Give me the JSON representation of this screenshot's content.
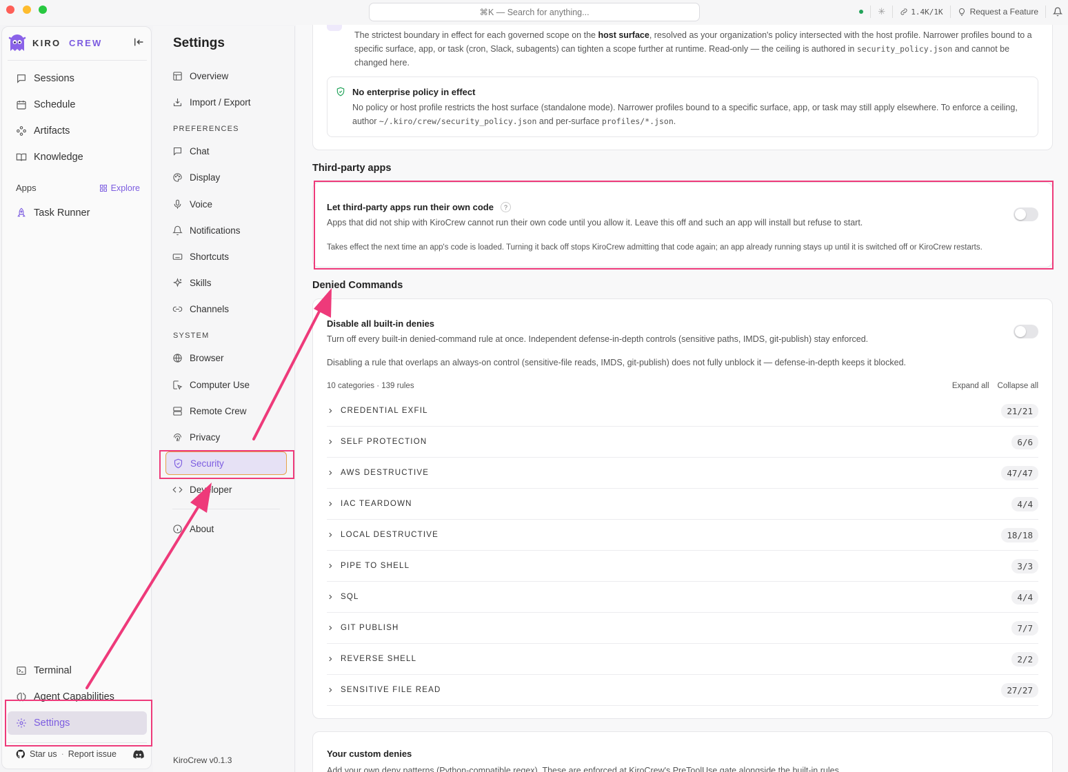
{
  "titlebar": {
    "search_placeholder": "⌘K — Search for anything...",
    "tokens": "1.4K/1K",
    "request_feature": "Request a Feature"
  },
  "sidebar": {
    "brand_kiro": "KIRO",
    "brand_crew": "CREW",
    "items": [
      {
        "label": "Sessions",
        "icon": "chat-bubble-icon"
      },
      {
        "label": "Schedule",
        "icon": "calendar-icon"
      },
      {
        "label": "Artifacts",
        "icon": "artifacts-icon"
      },
      {
        "label": "Knowledge",
        "icon": "book-icon"
      }
    ],
    "apps_label": "Apps",
    "explore_label": "Explore",
    "apps": [
      {
        "label": "Task Runner",
        "icon": "rocket-icon"
      }
    ],
    "bottom": [
      {
        "label": "Terminal",
        "icon": "terminal-icon"
      },
      {
        "label": "Agent Capabilities",
        "icon": "brain-icon"
      },
      {
        "label": "Settings",
        "icon": "gear-icon"
      }
    ],
    "star_us": "Star us",
    "dot": "·",
    "report_issue": "Report issue"
  },
  "settings_nav": {
    "title": "Settings",
    "top": [
      {
        "label": "Overview",
        "icon": "layout-icon"
      },
      {
        "label": "Import / Export",
        "icon": "import-icon"
      }
    ],
    "preferences_label": "PREFERENCES",
    "preferences": [
      {
        "label": "Chat",
        "icon": "chat-icon"
      },
      {
        "label": "Display",
        "icon": "palette-icon"
      },
      {
        "label": "Voice",
        "icon": "mic-icon"
      },
      {
        "label": "Notifications",
        "icon": "bell-icon"
      },
      {
        "label": "Shortcuts",
        "icon": "keyboard-icon"
      },
      {
        "label": "Skills",
        "icon": "sparkle-icon"
      },
      {
        "label": "Channels",
        "icon": "link-icon"
      }
    ],
    "system_label": "SYSTEM",
    "system": [
      {
        "label": "Browser",
        "icon": "globe-icon"
      },
      {
        "label": "Computer Use",
        "icon": "cursor-icon"
      },
      {
        "label": "Remote Crew",
        "icon": "server-icon"
      },
      {
        "label": "Privacy",
        "icon": "fingerprint-icon"
      },
      {
        "label": "Security",
        "icon": "shield-icon"
      },
      {
        "label": "Developer",
        "icon": "code-icon"
      }
    ],
    "about": "About",
    "version": "KiroCrew v0.1.3"
  },
  "policy": {
    "desc_1": "The strictest boundary in effect for each governed scope on the ",
    "desc_bold": "host surface",
    "desc_2": ", resolved as your organization's policy intersected with the host profile. Narrower profiles bound to a specific surface, app, or task (cron, Slack, subagents) can tighten a scope further at runtime. Read-only — the ceiling is authored in ",
    "desc_code": "security_policy.json",
    "desc_3": " and cannot be changed here.",
    "notice_title": "No enterprise policy in effect",
    "notice_1": "No policy or host profile restricts the host surface (standalone mode). Narrower profiles bound to a specific surface, app, or task may still apply elsewhere. To enforce a ceiling, author ",
    "notice_code1": "~/.kiro/crew/security_policy.json",
    "notice_2": " and per-surface ",
    "notice_code2": "profiles/*.json",
    "notice_3": "."
  },
  "third_party": {
    "title": "Third-party apps",
    "setting_title": "Let third-party apps run their own code",
    "help": "?",
    "desc": "Apps that did not ship with KiroCrew cannot run their own code until you allow it. Leave this off and such an app will install but refuse to start.",
    "note": "Takes effect the next time an app's code is loaded. Turning it back off stops KiroCrew admitting that code again; an app already running stays up until it is switched off or KiroCrew restarts.",
    "enabled": false
  },
  "denied": {
    "title": "Denied Commands",
    "setting_title": "Disable all built-in denies",
    "desc": "Turn off every built-in denied-command rule at once. Independent defense-in-depth controls (sensitive paths, IMDS, git-publish) stay enforced.",
    "note": "Disabling a rule that overlaps an always-on control (sensitive-file reads, IMDS, git-publish) does not fully unblock it — defense-in-depth keeps it blocked.",
    "enabled": false,
    "summary": "10 categories · 139 rules",
    "expand_all": "Expand all",
    "collapse_all": "Collapse all",
    "categories": [
      {
        "name": "CREDENTIAL EXFIL",
        "count": "21/21"
      },
      {
        "name": "SELF PROTECTION",
        "count": "6/6"
      },
      {
        "name": "AWS DESTRUCTIVE",
        "count": "47/47"
      },
      {
        "name": "IAC TEARDOWN",
        "count": "4/4"
      },
      {
        "name": "LOCAL DESTRUCTIVE",
        "count": "18/18"
      },
      {
        "name": "PIPE TO SHELL",
        "count": "3/3"
      },
      {
        "name": "SQL",
        "count": "4/4"
      },
      {
        "name": "GIT PUBLISH",
        "count": "7/7"
      },
      {
        "name": "REVERSE SHELL",
        "count": "2/2"
      },
      {
        "name": "SENSITIVE FILE READ",
        "count": "27/27"
      }
    ]
  },
  "custom": {
    "title": "Your custom denies",
    "desc": "Add your own deny patterns (Python-compatible regex). These are enforced at KiroCrew's PreToolUse gate alongside the built-in rules."
  },
  "colors": {
    "accent": "#7c5ce0",
    "highlight": "#ee3a7a",
    "active_border": "#e6a24a"
  }
}
